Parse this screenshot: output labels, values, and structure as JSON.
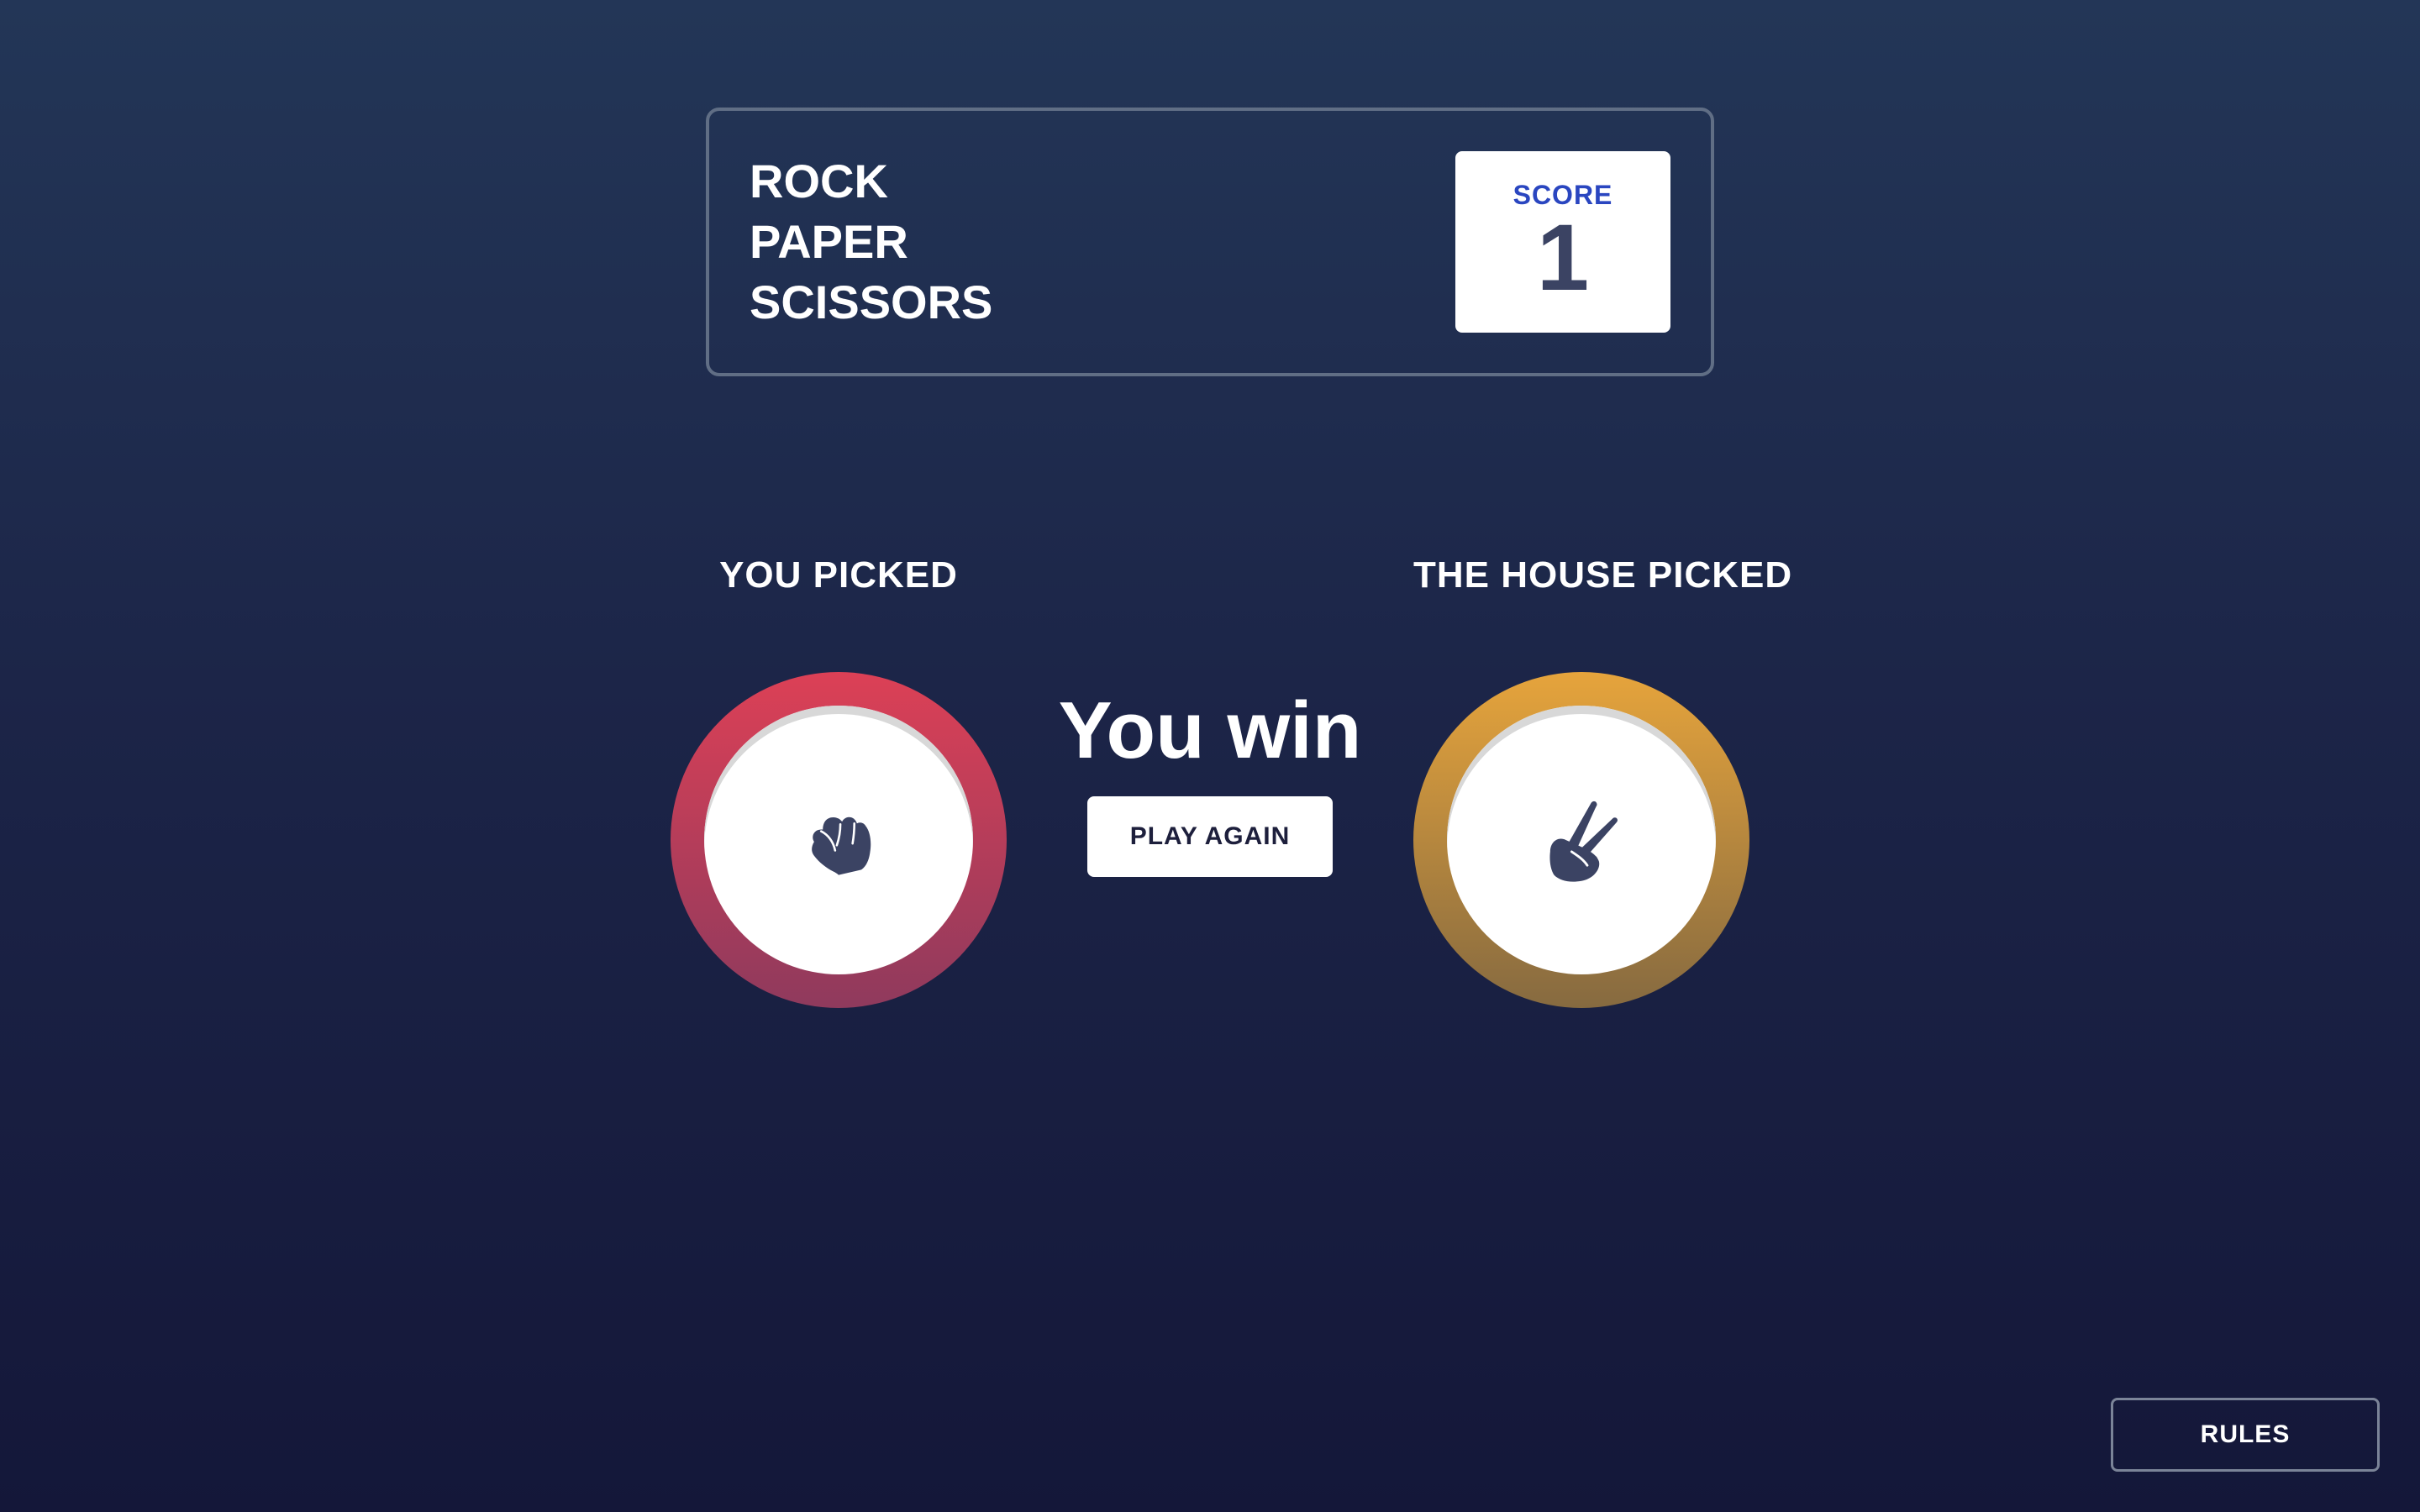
{
  "header": {
    "title_lines": [
      "ROCK",
      "PAPER",
      "SCISSORS"
    ],
    "score_label": "SCORE",
    "score_value": "1"
  },
  "game": {
    "you_picked_label": "YOU PICKED",
    "house_picked_label": "THE HOUSE PICKED",
    "player_pick": {
      "name": "rock",
      "icon": "rock-fist-icon",
      "ring_color_top": "#dc4056",
      "ring_color_bottom": "#8f3a5d"
    },
    "house_pick": {
      "name": "scissors",
      "icon": "scissors-hand-icon",
      "ring_color_top": "#e6a43c",
      "ring_color_bottom": "#866a40"
    },
    "result_text": "You win",
    "play_again_label": "PLAY AGAIN"
  },
  "footer": {
    "rules_label": "RULES"
  },
  "colors": {
    "background_top": "#233657",
    "background_bottom": "#141739",
    "score_label": "#2a46c0",
    "score_value": "#3b4363",
    "icon": "#3b4363"
  }
}
